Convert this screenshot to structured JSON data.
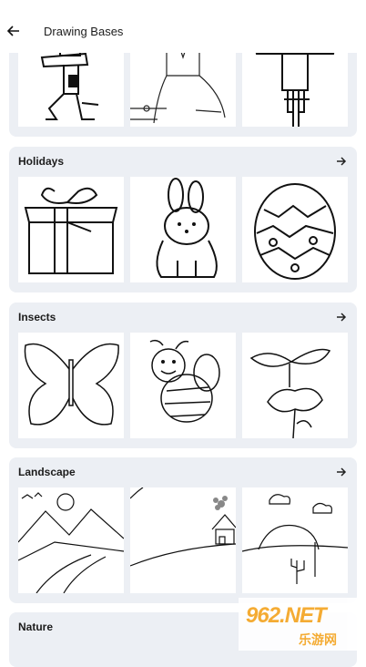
{
  "appbar": {
    "title": "Drawing Bases",
    "back_icon": "arrow-left-icon"
  },
  "categories": [
    {
      "name": "",
      "thumbnails": [
        "zombie-drawing",
        "seated-man-drawing",
        "scarecrow-drawing"
      ]
    },
    {
      "name": "Holidays",
      "thumbnails": [
        "gift-box-drawing",
        "bunny-drawing",
        "easter-egg-drawing"
      ]
    },
    {
      "name": "Insects",
      "thumbnails": [
        "butterfly-drawing",
        "bee-drawing",
        "dragonfly-flower-drawing"
      ]
    },
    {
      "name": "Landscape",
      "thumbnails": [
        "mountains-river-drawing",
        "hill-house-drawing",
        "sunset-cactus-drawing"
      ]
    },
    {
      "name": "Nature",
      "thumbnails": []
    }
  ],
  "watermark": {
    "text": "962.NET",
    "subtext": "乐游网"
  }
}
